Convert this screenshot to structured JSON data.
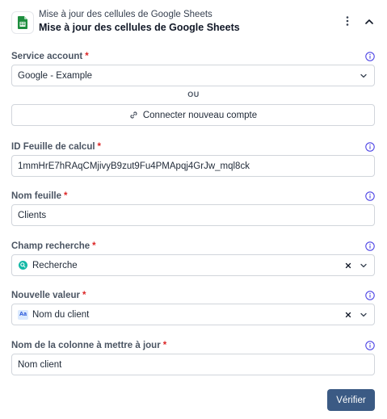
{
  "header": {
    "subtitle": "Mise à jour des cellules de Google Sheets",
    "title": "Mise à jour des cellules de Google Sheets"
  },
  "service_account": {
    "label": "Service account",
    "required_mark": "*",
    "value": "Google - Example"
  },
  "or_separator": "OU",
  "connect_button": "Connecter nouveau compte",
  "spreadsheet_id": {
    "label": "ID Feuille de calcul",
    "required_mark": "*",
    "value": "1mmHrE7hRAqCMjivyB9zut9Fu4PMApqj4GrJw_mql8ck"
  },
  "sheet_name": {
    "label": "Nom feuille",
    "required_mark": "*",
    "value": "Clients"
  },
  "search_field": {
    "label": "Champ recherche",
    "required_mark": "*",
    "value": "Recherche"
  },
  "new_value": {
    "label": "Nouvelle valeur",
    "required_mark": "*",
    "badge": "Aa",
    "value": "Nom du client"
  },
  "column_name": {
    "label": "Nom de la colonne à mettre à jour",
    "required_mark": "*",
    "value": "Nom client"
  },
  "verify_button": "Vérifier",
  "colors": {
    "primary": "#3b5a84",
    "required": "#dc2626",
    "info_icon": "#4f46e5",
    "sheets_green": "#1e8e3e"
  }
}
